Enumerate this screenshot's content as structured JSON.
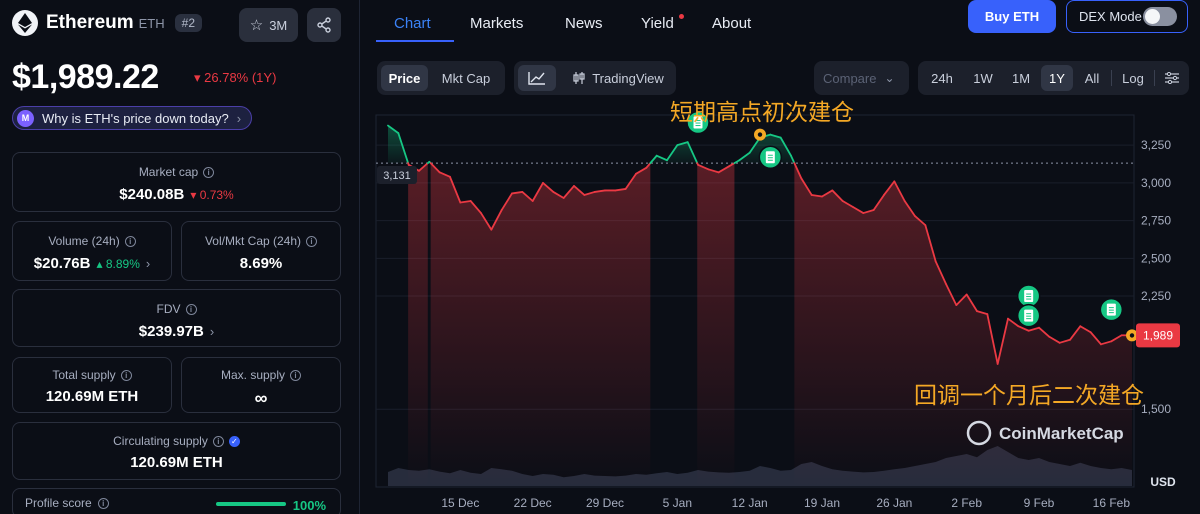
{
  "coin": {
    "name": "Ethereum",
    "symbol": "ETH",
    "rank": "#2",
    "watchlist_count": "3M",
    "price": "$1,989.22",
    "change": "26.78% (1Y)",
    "why_prompt": "Why is ETH's price down today?"
  },
  "stats": {
    "market_cap": {
      "label": "Market cap",
      "value": "$240.08B",
      "change": "0.73%"
    },
    "volume": {
      "label": "Volume (24h)",
      "value": "$20.76B",
      "change": "8.89%"
    },
    "vol_mkt": {
      "label": "Vol/Mkt Cap (24h)",
      "value": "8.69%"
    },
    "fdv": {
      "label": "FDV",
      "value": "$239.97B"
    },
    "total_supply": {
      "label": "Total supply",
      "value": "120.69M ETH"
    },
    "max_supply": {
      "label": "Max. supply",
      "value": "∞"
    },
    "circulating_supply": {
      "label": "Circulating supply",
      "value": "120.69M ETH"
    },
    "profile_score": {
      "label": "Profile score",
      "value": "100%"
    }
  },
  "tabs": [
    "Chart",
    "Markets",
    "News",
    "Yield",
    "About"
  ],
  "buy_label": "Buy ETH",
  "dex_label": "DEX Mode",
  "toolbar": {
    "price": "Price",
    "mkt_cap": "Mkt Cap",
    "tradingview": "TradingView",
    "compare": "Compare",
    "ranges": [
      "24h",
      "1W",
      "1M",
      "1Y",
      "All"
    ],
    "active_range": "1Y",
    "log": "Log"
  },
  "annotations": {
    "top": "短期高点初次建仓",
    "bottom": "回调一个月后二次建仓"
  },
  "watermark": "CoinMarketCap",
  "colors": {
    "up": "#16c784",
    "down": "#ea3943",
    "accent": "#3861fb",
    "annotation": "#f4a825"
  },
  "chart_data": {
    "type": "line",
    "series": [
      {
        "x": [
          "2024-12-08",
          "2024-12-09",
          "2024-12-10",
          "2024-12-11",
          "2024-12-12",
          "2024-12-13",
          "2024-12-14",
          "2024-12-15",
          "2024-12-16",
          "2024-12-17",
          "2024-12-18",
          "2024-12-19",
          "2024-12-20",
          "2024-12-21",
          "2024-12-22",
          "2024-12-23",
          "2024-12-24",
          "2024-12-25",
          "2024-12-26",
          "2024-12-27",
          "2024-12-28",
          "2024-12-29",
          "2024-12-30",
          "2024-12-31",
          "2025-01-01",
          "2025-01-02",
          "2025-01-03",
          "2025-01-04",
          "2025-01-05",
          "2025-01-06",
          "2025-01-07",
          "2025-01-08",
          "2025-01-09",
          "2025-01-10",
          "2025-01-11",
          "2025-01-12",
          "2025-01-13",
          "2025-01-14",
          "2025-01-15",
          "2025-01-16",
          "2025-01-17",
          "2025-01-18",
          "2025-01-19",
          "2025-01-20",
          "2025-01-21",
          "2025-01-22",
          "2025-01-23",
          "2025-01-24",
          "2025-01-25",
          "2025-01-26",
          "2025-01-27",
          "2025-01-28",
          "2025-01-29",
          "2025-01-30",
          "2025-01-31",
          "2025-02-01",
          "2025-02-02",
          "2025-02-03",
          "2025-02-04",
          "2025-02-05",
          "2025-02-06",
          "2025-02-07",
          "2025-02-08",
          "2025-02-09",
          "2025-02-10",
          "2025-02-11",
          "2025-02-12",
          "2025-02-13",
          "2025-02-14",
          "2025-02-15",
          "2025-02-16",
          "2025-02-17",
          "2025-02-18"
        ],
        "values": [
          3380,
          3330,
          3120,
          3080,
          3140,
          3070,
          3040,
          2870,
          2880,
          2800,
          2690,
          2820,
          2930,
          2940,
          2880,
          3000,
          2940,
          2900,
          2980,
          2920,
          2940,
          2950,
          2950,
          2960,
          3060,
          3100,
          3180,
          3150,
          3250,
          3270,
          3120,
          3090,
          3070,
          3110,
          3150,
          3200,
          3300,
          3320,
          3300,
          3180,
          3030,
          2920,
          2910,
          2950,
          2880,
          2840,
          2800,
          2820,
          2920,
          3010,
          2880,
          2780,
          2720,
          2480,
          2330,
          2190,
          2260,
          2150,
          2130,
          1800,
          2100,
          2050,
          2020,
          2040,
          1980,
          1940,
          1960,
          2050,
          2010,
          1930,
          1950,
          1990,
          1989
        ]
      }
    ],
    "volume": [
      0.35,
      0.45,
      0.4,
      0.38,
      0.42,
      0.36,
      0.32,
      0.4,
      0.33,
      0.3,
      0.45,
      0.42,
      0.38,
      0.3,
      0.25,
      0.3,
      0.28,
      0.22,
      0.25,
      0.3,
      0.26,
      0.25,
      0.24,
      0.26,
      0.3,
      0.28,
      0.32,
      0.35,
      0.3,
      0.33,
      0.4,
      0.36,
      0.34,
      0.33,
      0.35,
      0.38,
      0.5,
      0.45,
      0.38,
      0.4,
      0.55,
      0.6,
      0.5,
      0.42,
      0.38,
      0.36,
      0.34,
      0.35,
      0.38,
      0.42,
      0.45,
      0.5,
      0.55,
      0.6,
      0.7,
      0.75,
      0.8,
      0.72,
      0.9,
      1.0,
      0.85,
      0.7,
      0.65,
      0.7,
      0.6,
      0.55,
      0.5,
      0.58,
      0.5,
      0.45,
      0.42,
      0.45,
      0.4
    ],
    "baseline": 3131,
    "last_price": 1989,
    "y_ticks": [
      3250,
      3000,
      2750,
      2500,
      2250,
      1500
    ],
    "x_ticks": [
      "15 Dec",
      "22 Dec",
      "29 Dec",
      "5 Jan",
      "12 Jan",
      "19 Jan",
      "26 Jan",
      "2 Feb",
      "9 Feb",
      "16 Feb"
    ],
    "y_unit": "USD",
    "ylim": [
      1150,
      3450
    ],
    "markers": [
      {
        "type": "note",
        "x": "2025-01-07",
        "y": 3400
      },
      {
        "type": "note",
        "x": "2025-01-14",
        "y": 3170
      },
      {
        "type": "note",
        "x": "2025-02-08",
        "y": 2250
      },
      {
        "type": "note",
        "x": "2025-02-08",
        "y": 2120
      },
      {
        "type": "note",
        "x": "2025-02-16",
        "y": 2160
      },
      {
        "type": "pin",
        "x": "2025-01-13",
        "y": 3320
      },
      {
        "type": "pin",
        "x": "2025-02-18",
        "y": 1989
      }
    ]
  }
}
